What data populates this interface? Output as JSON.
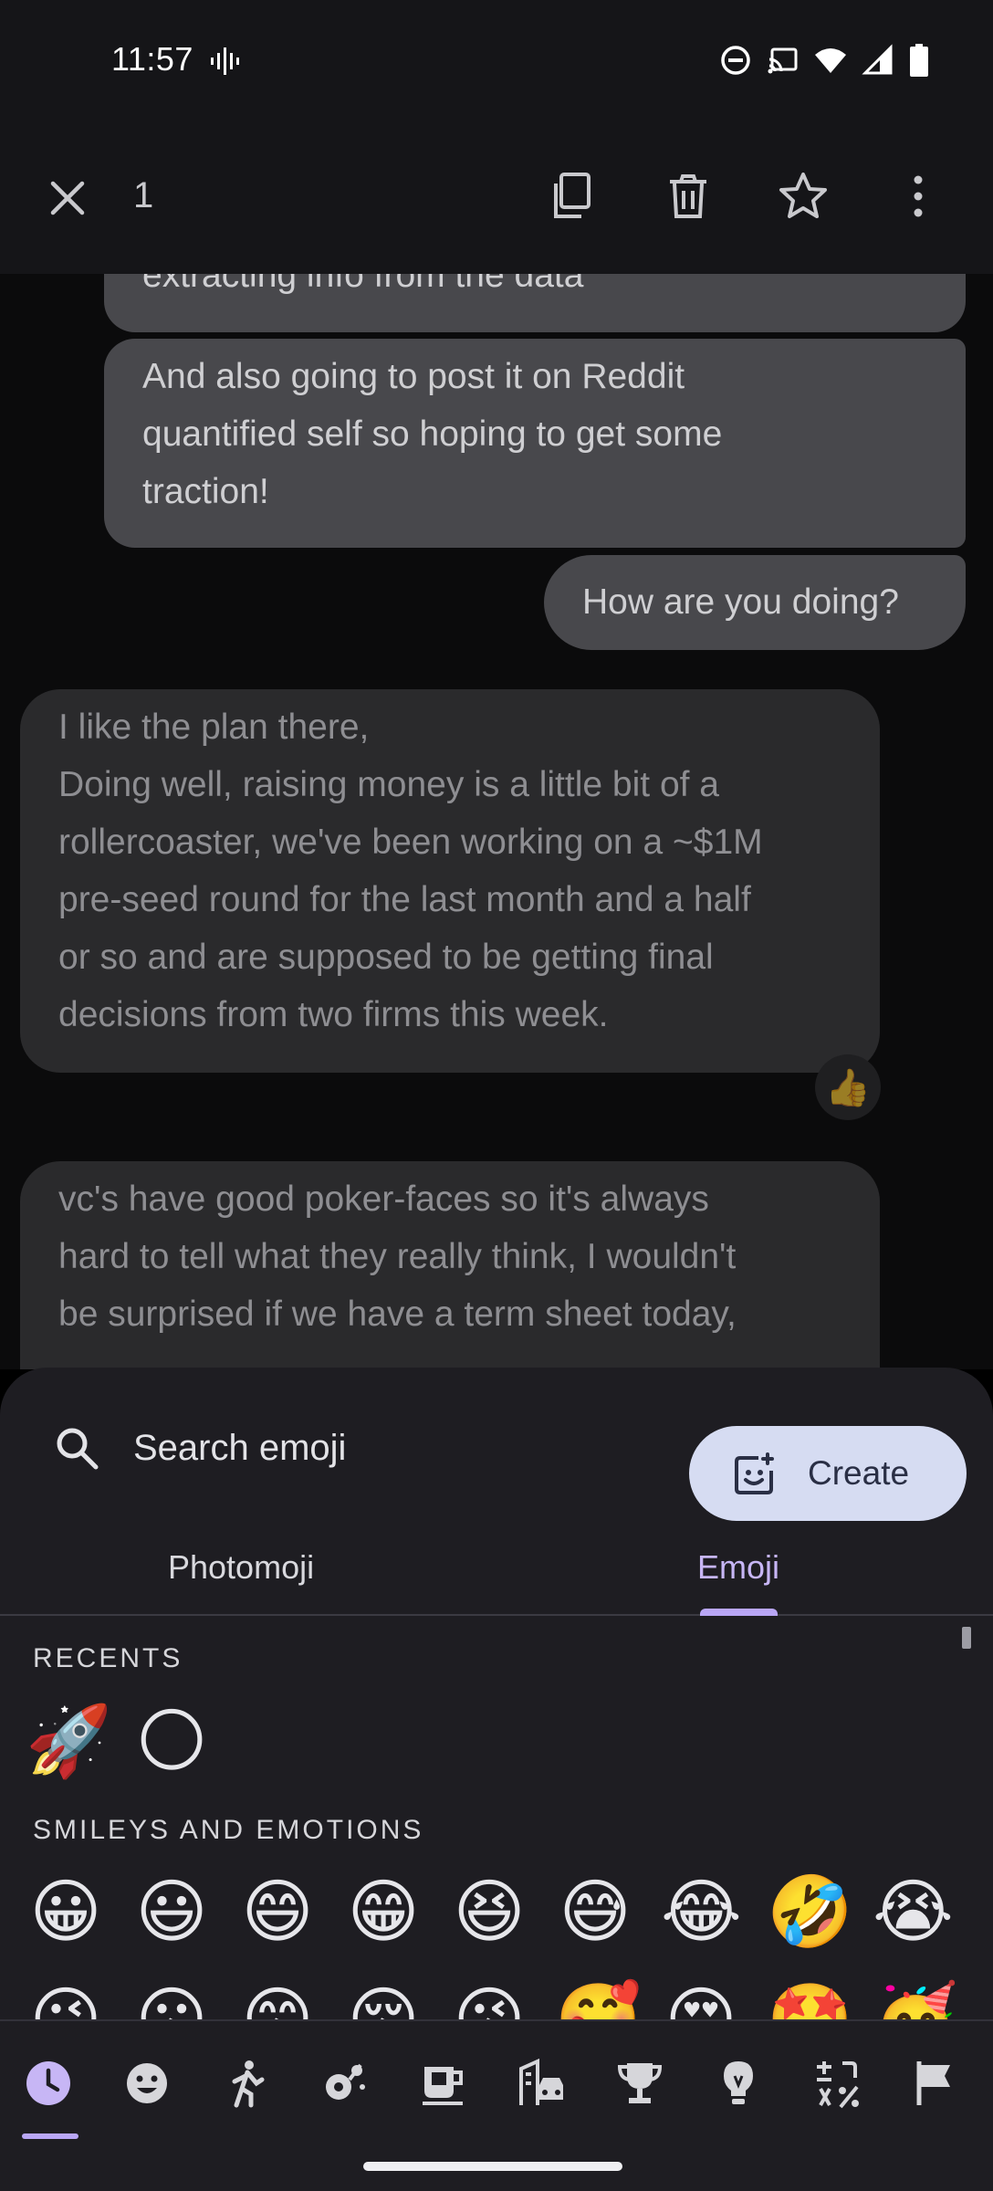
{
  "status_bar": {
    "time": "11:57",
    "icons": [
      "voice-recorder-icon",
      "do-not-disturb-icon",
      "cast-icon",
      "wifi-icon",
      "signal-icon",
      "battery-icon"
    ]
  },
  "app_bar": {
    "selected_count": "1",
    "actions": [
      "copy-icon",
      "delete-icon",
      "star-icon",
      "more-vert-icon"
    ]
  },
  "messages": [
    {
      "side": "out",
      "lines": [
        "extracting info from the data"
      ]
    },
    {
      "side": "out",
      "lines": [
        "And also going to post it on Reddit",
        "quantified self so hoping to get some",
        "traction!"
      ]
    },
    {
      "side": "out",
      "lines": [
        "How are you doing?"
      ]
    },
    {
      "side": "in",
      "lines": [
        "I like the plan there,",
        "Doing well, raising money is a little bit of a",
        "rollercoaster, we've been working on a ~$1M",
        "pre-seed round for the last month and a half",
        "or so and are supposed to be getting final",
        "decisions from two firms this week."
      ],
      "reaction": "👍"
    },
    {
      "side": "in",
      "lines": [
        "vc's have good poker-faces so it's always",
        "hard to tell what they really think, I wouldn't",
        "be surprised if we have a term sheet today,"
      ]
    }
  ],
  "emoji_sheet": {
    "search_placeholder": "Search emoji",
    "create_label": "Create",
    "tabs": [
      "Photomoji",
      "Emoji"
    ],
    "active_tab": "Emoji",
    "sections": [
      {
        "title": "RECENTS",
        "emojis": [
          "🚀",
          "🌕"
        ]
      },
      {
        "title": "SMILEYS AND EMOTIONS",
        "emojis": [
          "😀",
          "😃",
          "😄",
          "😁",
          "😆",
          "😅",
          "😂",
          "🤣",
          "😭",
          "😉",
          "😗",
          "😙",
          "😚",
          "😘",
          "🥰",
          "😍",
          "🤩",
          "🥳"
        ]
      }
    ],
    "categories": [
      "recents-clock-icon",
      "smiley-icon",
      "person-icon",
      "nature-icon",
      "food-icon",
      "travel-icon",
      "activity-trophy-icon",
      "objects-bulb-icon",
      "symbols-icon",
      "flag-icon"
    ],
    "active_category": "recents-clock-icon"
  },
  "colors": {
    "accent": "#b9a6f5",
    "sheet_bg": "#1e1d22",
    "create_button_bg": "#d6dcf2"
  }
}
